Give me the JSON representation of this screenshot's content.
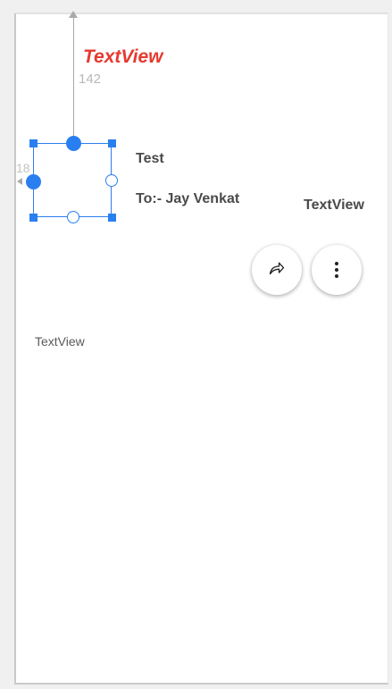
{
  "layout_editor": {
    "top_constraint_label": "TextView",
    "top_constraint_value": "142",
    "left_constraint_value": "18"
  },
  "content": {
    "title": "Test",
    "recipient": "To:- Jay Venkat",
    "right_textview": "TextView",
    "left_textview": "TextView"
  },
  "actions": {
    "share_icon": "share-arrow-icon",
    "more_icon": "more-vert-icon"
  },
  "colors": {
    "selection_blue": "#2a7ff0",
    "label_red": "#e53a2f",
    "text_gray": "#4a4a4a",
    "frame_background": "#ffffff",
    "page_background": "#f0f0f0"
  }
}
